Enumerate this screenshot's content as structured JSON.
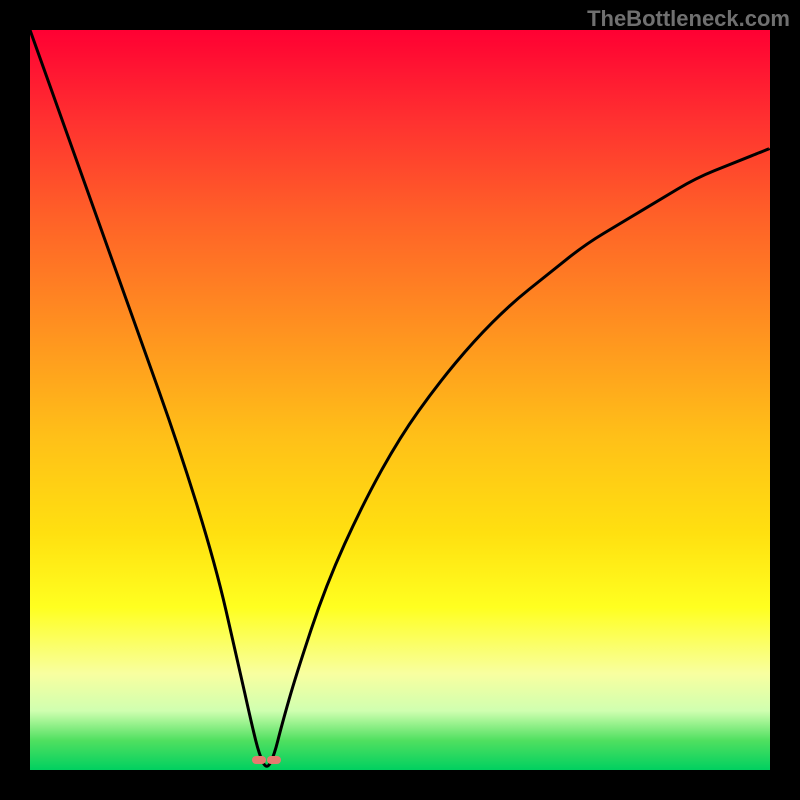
{
  "watermark": "TheBottleneck.com",
  "chart_data": {
    "type": "line",
    "title": "",
    "xlabel": "",
    "ylabel": "",
    "xlim": [
      0,
      100
    ],
    "ylim": [
      0,
      100
    ],
    "x": [
      0,
      5,
      10,
      15,
      20,
      25,
      28,
      30,
      31,
      32,
      33,
      34,
      36,
      40,
      45,
      50,
      55,
      60,
      65,
      70,
      75,
      80,
      85,
      90,
      95,
      100
    ],
    "values": [
      100,
      86,
      72,
      58,
      44,
      28,
      15,
      6,
      2,
      0,
      2,
      6,
      13,
      25,
      36,
      45,
      52,
      58,
      63,
      67,
      71,
      74,
      77,
      80,
      82,
      84
    ],
    "minimum_x": 32,
    "markers_x": [
      31,
      33
    ],
    "curve_color": "#000000",
    "gradient_top": "#ff0033",
    "gradient_bottom": "#00d060"
  }
}
